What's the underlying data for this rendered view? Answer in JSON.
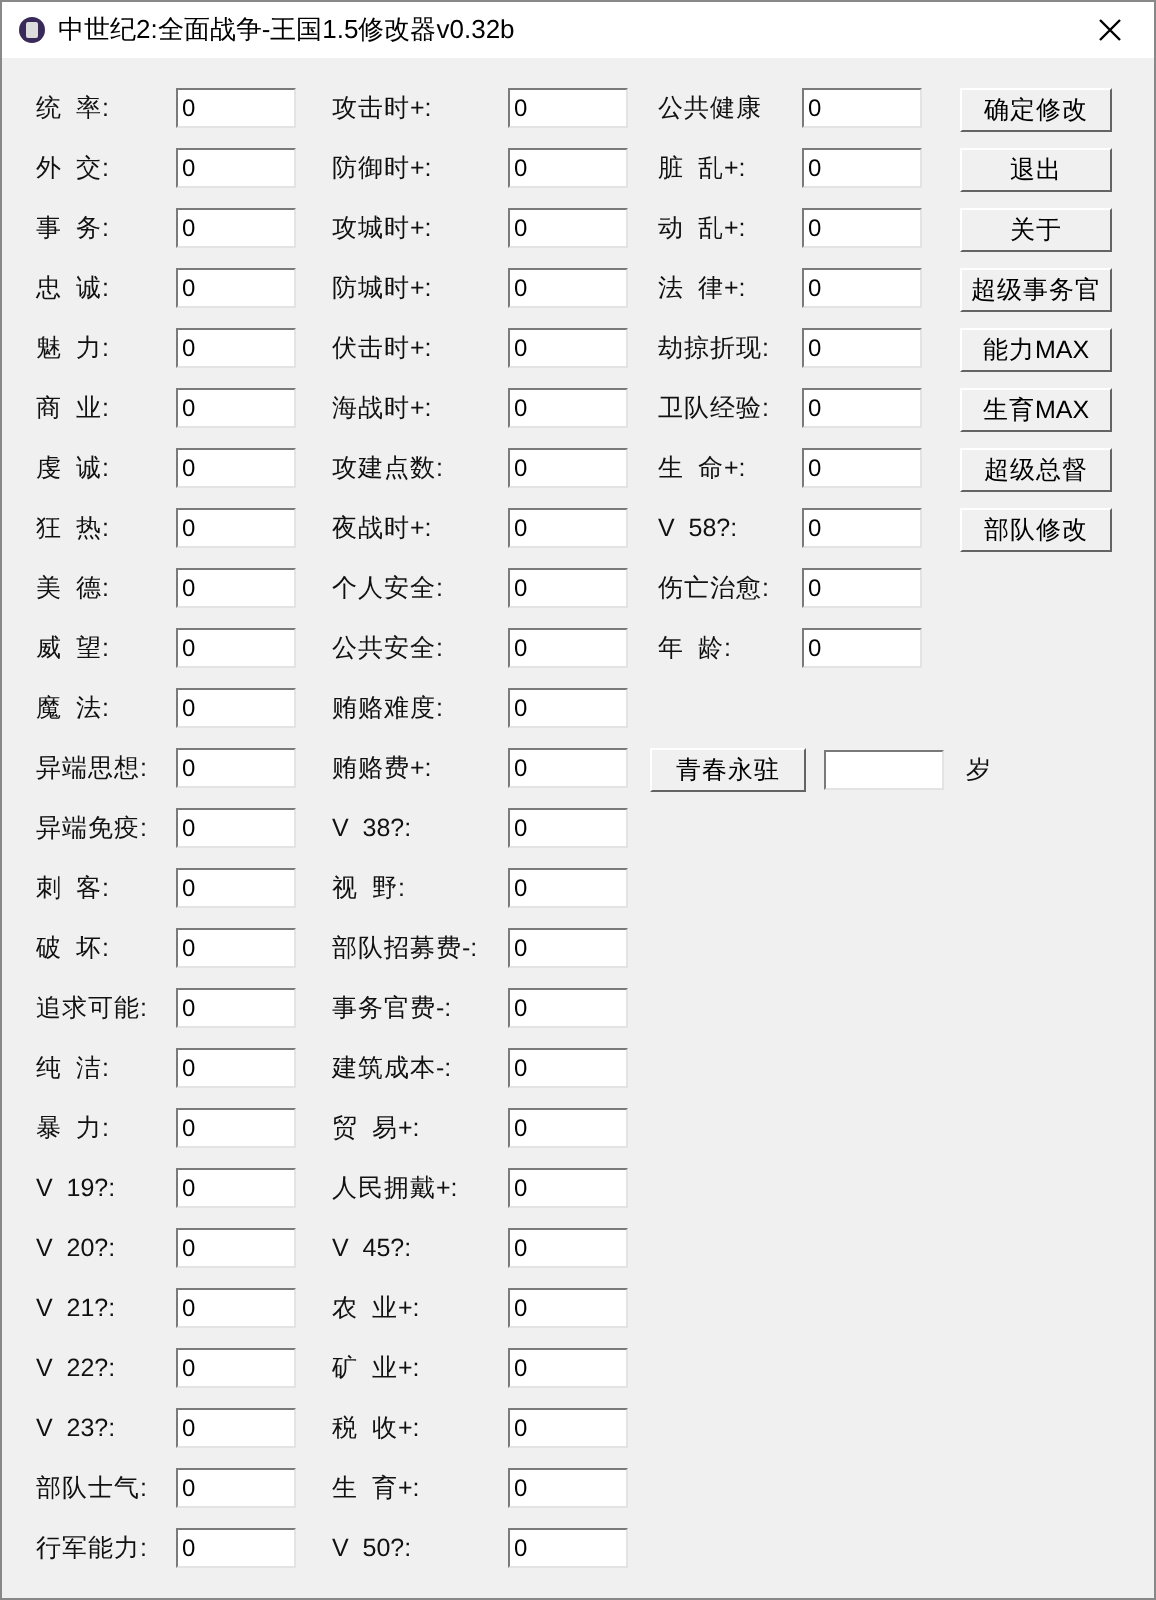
{
  "window": {
    "title": "中世纪2:全面战争-王国1.5修改器v0.32b"
  },
  "left_fields": [
    {
      "label": "统  率:",
      "value": "0"
    },
    {
      "label": "外  交:",
      "value": "0"
    },
    {
      "label": "事  务:",
      "value": "0"
    },
    {
      "label": "忠  诚:",
      "value": "0"
    },
    {
      "label": "魅  力:",
      "value": "0"
    },
    {
      "label": "商  业:",
      "value": "0"
    },
    {
      "label": "虔  诚:",
      "value": "0"
    },
    {
      "label": "狂  热:",
      "value": "0"
    },
    {
      "label": "美  德:",
      "value": "0"
    },
    {
      "label": "威  望:",
      "value": "0"
    },
    {
      "label": "魔  法:",
      "value": "0"
    },
    {
      "label": "异端思想:",
      "value": "0"
    },
    {
      "label": "异端免疫:",
      "value": "0"
    },
    {
      "label": "刺  客:",
      "value": "0"
    },
    {
      "label": "破  坏:",
      "value": "0"
    },
    {
      "label": "追求可能:",
      "value": "0"
    },
    {
      "label": "纯  洁:",
      "value": "0"
    },
    {
      "label": "暴  力:",
      "value": "0"
    },
    {
      "label": "V  19?:",
      "value": "0"
    },
    {
      "label": "V  20?:",
      "value": "0"
    },
    {
      "label": "V  21?:",
      "value": "0"
    },
    {
      "label": "V  22?:",
      "value": "0"
    },
    {
      "label": "V  23?:",
      "value": "0"
    },
    {
      "label": "部队士气:",
      "value": "0"
    },
    {
      "label": "行军能力:",
      "value": "0"
    }
  ],
  "middle_fields": [
    {
      "label": "攻击时+:",
      "value": "0"
    },
    {
      "label": "防御时+:",
      "value": "0"
    },
    {
      "label": "攻城时+:",
      "value": "0"
    },
    {
      "label": "防城时+:",
      "value": "0"
    },
    {
      "label": "伏击时+:",
      "value": "0"
    },
    {
      "label": "海战时+:",
      "value": "0"
    },
    {
      "label": "攻建点数:",
      "value": "0"
    },
    {
      "label": "夜战时+:",
      "value": "0"
    },
    {
      "label": "个人安全:",
      "value": "0"
    },
    {
      "label": "公共安全:",
      "value": "0"
    },
    {
      "label": "贿赂难度:",
      "value": "0"
    },
    {
      "label": "贿赂费+:",
      "value": "0"
    },
    {
      "label": "V  38?:",
      "value": "0"
    },
    {
      "label": "视  野:",
      "value": "0"
    },
    {
      "label": "部队招募费-:",
      "value": "0"
    },
    {
      "label": "事务官费-:",
      "value": "0"
    },
    {
      "label": "建筑成本-:",
      "value": "0"
    },
    {
      "label": "贸  易+:",
      "value": "0"
    },
    {
      "label": "人民拥戴+:",
      "value": "0"
    },
    {
      "label": "V  45?:",
      "value": "0"
    },
    {
      "label": "农  业+:",
      "value": "0"
    },
    {
      "label": "矿  业+:",
      "value": "0"
    },
    {
      "label": "税  收+:",
      "value": "0"
    },
    {
      "label": "生  育+:",
      "value": "0"
    },
    {
      "label": "V  50?:",
      "value": "0"
    }
  ],
  "right_fields": [
    {
      "label": "公共健康",
      "value": "0"
    },
    {
      "label": "脏  乱+:",
      "value": "0"
    },
    {
      "label": "动  乱+:",
      "value": "0"
    },
    {
      "label": "法  律+:",
      "value": "0"
    },
    {
      "label": "劫掠折现:",
      "value": "0"
    },
    {
      "label": "卫队经验:",
      "value": "0"
    },
    {
      "label": "生  命+:",
      "value": "0"
    },
    {
      "label": "V  58?:",
      "value": "0"
    },
    {
      "label": "伤亡治愈:",
      "value": "0"
    },
    {
      "label": "年  龄:",
      "value": "0"
    }
  ],
  "buttons": [
    "确定修改",
    "退出",
    "关于",
    "超级事务官",
    "能力MAX",
    "生育MAX",
    "超级总督",
    "部队修改"
  ],
  "youth": {
    "button": "青春永驻",
    "unit": "岁"
  }
}
